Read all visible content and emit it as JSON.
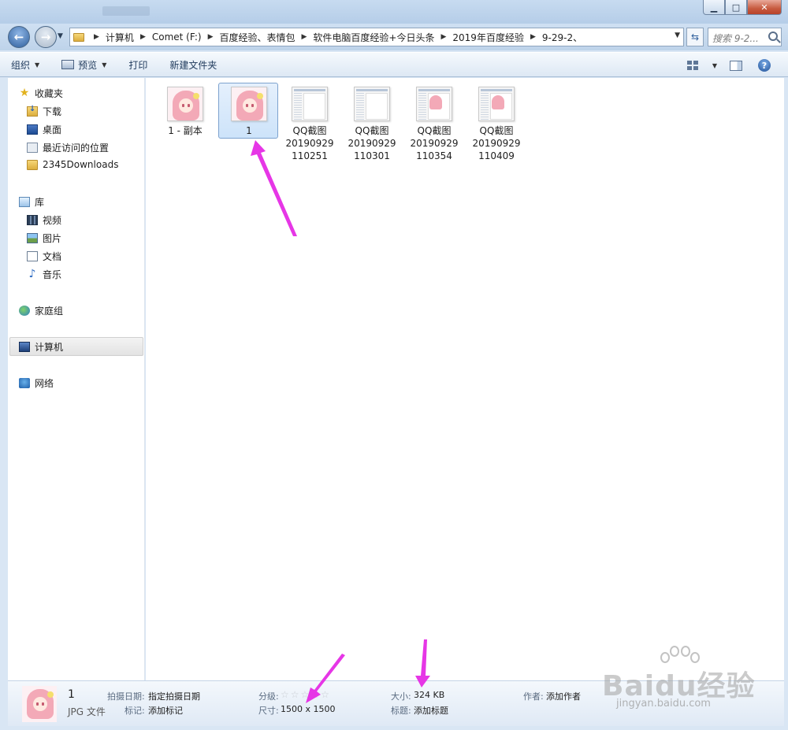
{
  "window": {
    "minimize": "▁",
    "maximize": "□",
    "close": "✕"
  },
  "address": {
    "breadcrumbs": [
      "计算机",
      "Comet (F:)",
      "百度经验、表情包",
      "软件电脑百度经验+今日头条",
      "2019年百度经验",
      "9-29-2、"
    ],
    "search_placeholder": "搜索 9-2..."
  },
  "toolbar": {
    "organize": "组织",
    "preview": "预览",
    "print": "打印",
    "new_folder": "新建文件夹"
  },
  "nav": {
    "favorites": "收藏夹",
    "downloads": "下载",
    "desktop": "桌面",
    "recent": "最近访问的位置",
    "downloads2345": "2345Downloads",
    "libraries": "库",
    "videos": "视频",
    "pictures": "图片",
    "documents": "文档",
    "music": "音乐",
    "homegroup": "家庭组",
    "computer": "计算机",
    "network": "网络"
  },
  "files": [
    {
      "name": "1 - 副本",
      "kind": "anime"
    },
    {
      "name": "1",
      "kind": "anime",
      "selected": true
    },
    {
      "name": "QQ截图 20190929 110251",
      "line1": "QQ截图",
      "line2": "20190929",
      "line3": "110251",
      "kind": "shot"
    },
    {
      "name": "QQ截图 20190929 110301",
      "line1": "QQ截图",
      "line2": "20190929",
      "line3": "110301",
      "kind": "shot"
    },
    {
      "name": "QQ截图 20190929 110354",
      "line1": "QQ截图",
      "line2": "20190929",
      "line3": "110354",
      "kind": "shot-anime"
    },
    {
      "name": "QQ截图 20190929 110409",
      "line1": "QQ截图",
      "line2": "20190929",
      "line3": "110409",
      "kind": "shot-anime"
    }
  ],
  "details": {
    "name": "1",
    "type": "JPG 文件",
    "date_taken_label": "拍摄日期:",
    "date_taken_value": "指定拍摄日期",
    "tags_label": "标记:",
    "tags_value": "添加标记",
    "rating_label": "分级:",
    "rating_stars": 0,
    "dimensions_label": "尺寸:",
    "dimensions_value": "1500 x 1500",
    "size_label": "大小:",
    "size_value": "324 KB",
    "title_label": "标题:",
    "title_value": "添加标题",
    "author_label": "作者:",
    "author_value": "添加作者"
  },
  "watermark": {
    "brand": "Baidu经验",
    "url": "jingyan.baidu.com"
  },
  "colors": {
    "annotation_arrow": "#e636e6",
    "selection": "#cde3fa",
    "chrome": "#c7dbf0"
  }
}
